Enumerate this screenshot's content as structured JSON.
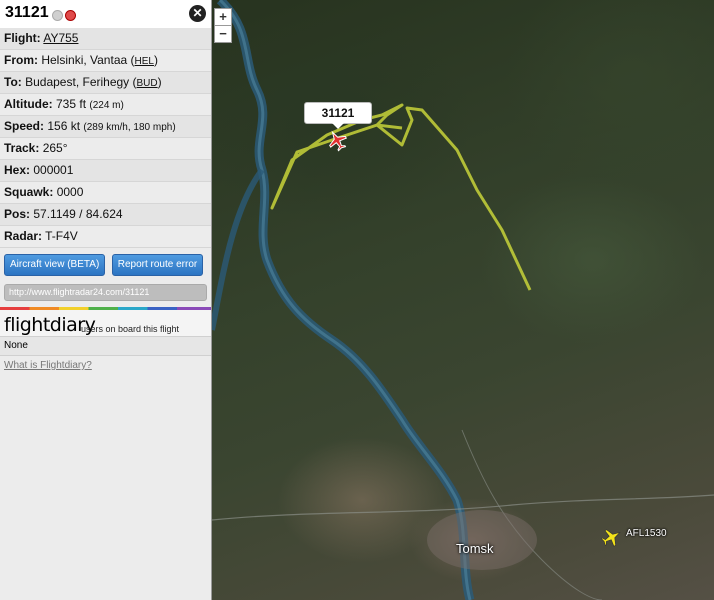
{
  "panel": {
    "title": "31121",
    "rows": [
      {
        "label": "Flight:",
        "value": "",
        "link": "AY755",
        "extra": ""
      },
      {
        "label": "From:",
        "value": "Helsinki, Vantaa (",
        "link": "HEL",
        "extra": ")"
      },
      {
        "label": "To:",
        "value": "Budapest, Ferihegy (",
        "link": "BUD",
        "extra": ")"
      },
      {
        "label": "Altitude:",
        "value": "735 ft",
        "small": "(224 m)"
      },
      {
        "label": "Speed:",
        "value": "156 kt",
        "small": "(289 km/h, 180 mph)"
      },
      {
        "label": "Track:",
        "value": "265°"
      },
      {
        "label": "Hex:",
        "value": "000001"
      },
      {
        "label": "Squawk:",
        "value": "0000"
      },
      {
        "label": "Pos:",
        "value": "57.1149 / 84.624"
      },
      {
        "label": "Radar:",
        "value": "T-F4V"
      }
    ],
    "buttons": {
      "aircraft_view": "Aircraft view (BETA)",
      "report_route": "Report route error"
    },
    "url": "http://www.flightradar24.com/31121",
    "flightdiary": {
      "logo": "flightdiary",
      "subtitle": "users on board this flight",
      "none": "None",
      "what_link": "What is Flightdiary?"
    }
  },
  "map": {
    "zoom_in": "+",
    "zoom_out": "−",
    "selected_callout": "31121",
    "city": "Tomsk",
    "other_flight": "AFL1530",
    "track_color": "#c8d43a",
    "selected_plane_color": "#e23030",
    "other_plane_color": "#f2e21a"
  },
  "icons": {
    "close": "close-icon",
    "plane": "airplane-icon"
  }
}
